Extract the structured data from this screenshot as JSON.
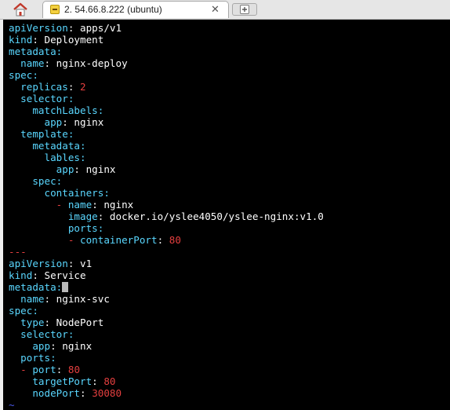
{
  "tabbar": {
    "home_icon": "home-icon",
    "tab_label": "2. 54.66.8.222 (ubuntu)",
    "tab_icon": "terminal-icon",
    "close_label": "✕",
    "new_tab_icon": "plus-icon"
  },
  "colors": {
    "key": "#5ad7ff",
    "special": "#e53f3f",
    "text": "#ffffff",
    "background": "#000000",
    "tilde": "#4a58e8"
  },
  "lines": [
    [
      {
        "t": "apiVersion",
        "c": "k"
      },
      {
        "t": ": apps/v1"
      }
    ],
    [
      {
        "t": "kind",
        "c": "k"
      },
      {
        "t": ": Deployment"
      }
    ],
    [
      {
        "t": "metadata:",
        "c": "k"
      }
    ],
    [
      {
        "t": "  "
      },
      {
        "t": "name",
        "c": "k"
      },
      {
        "t": ": nginx-deploy"
      }
    ],
    [
      {
        "t": "spec:",
        "c": "k"
      }
    ],
    [
      {
        "t": "  "
      },
      {
        "t": "replicas",
        "c": "k"
      },
      {
        "t": ": "
      },
      {
        "t": "2",
        "c": "s"
      }
    ],
    [
      {
        "t": "  "
      },
      {
        "t": "selector:",
        "c": "k"
      }
    ],
    [
      {
        "t": "    "
      },
      {
        "t": "matchLabels:",
        "c": "k"
      }
    ],
    [
      {
        "t": "      "
      },
      {
        "t": "app",
        "c": "k"
      },
      {
        "t": ": nginx"
      }
    ],
    [
      {
        "t": "  "
      },
      {
        "t": "template:",
        "c": "k"
      }
    ],
    [
      {
        "t": "    "
      },
      {
        "t": "metadata:",
        "c": "k"
      }
    ],
    [
      {
        "t": "      "
      },
      {
        "t": "lables:",
        "c": "k"
      }
    ],
    [
      {
        "t": "        "
      },
      {
        "t": "app",
        "c": "k"
      },
      {
        "t": ": nginx"
      }
    ],
    [
      {
        "t": "    "
      },
      {
        "t": "spec:",
        "c": "k"
      }
    ],
    [
      {
        "t": "      "
      },
      {
        "t": "containers:",
        "c": "k"
      }
    ],
    [
      {
        "t": "        "
      },
      {
        "t": "- ",
        "c": "s"
      },
      {
        "t": "name",
        "c": "k"
      },
      {
        "t": ": nginx"
      }
    ],
    [
      {
        "t": "          "
      },
      {
        "t": "image",
        "c": "k"
      },
      {
        "t": ": docker.io/yslee4050/yslee-nginx:v1.0"
      }
    ],
    [
      {
        "t": "          "
      },
      {
        "t": "ports:",
        "c": "k"
      }
    ],
    [
      {
        "t": "          "
      },
      {
        "t": "- ",
        "c": "s"
      },
      {
        "t": "containerPort",
        "c": "k"
      },
      {
        "t": ": "
      },
      {
        "t": "80",
        "c": "s"
      }
    ],
    [
      {
        "t": "---",
        "c": "s"
      }
    ],
    [
      {
        "t": "apiVersion",
        "c": "k"
      },
      {
        "t": ": v1"
      }
    ],
    [
      {
        "t": "kind",
        "c": "k"
      },
      {
        "t": ": Service"
      }
    ],
    [
      {
        "t": "metadata:",
        "c": "k"
      },
      {
        "t": "",
        "cursor": true
      }
    ],
    [
      {
        "t": "  "
      },
      {
        "t": "name",
        "c": "k"
      },
      {
        "t": ": nginx-svc"
      }
    ],
    [
      {
        "t": "spec:",
        "c": "k"
      }
    ],
    [
      {
        "t": "  "
      },
      {
        "t": "type",
        "c": "k"
      },
      {
        "t": ": NodePort"
      }
    ],
    [
      {
        "t": "  "
      },
      {
        "t": "selector:",
        "c": "k"
      }
    ],
    [
      {
        "t": "    "
      },
      {
        "t": "app",
        "c": "k"
      },
      {
        "t": ": nginx"
      }
    ],
    [
      {
        "t": "  "
      },
      {
        "t": "ports:",
        "c": "k"
      }
    ],
    [
      {
        "t": "  "
      },
      {
        "t": "- ",
        "c": "s"
      },
      {
        "t": "port",
        "c": "k"
      },
      {
        "t": ": "
      },
      {
        "t": "80",
        "c": "s"
      }
    ],
    [
      {
        "t": "    "
      },
      {
        "t": "targetPort",
        "c": "k"
      },
      {
        "t": ": "
      },
      {
        "t": "80",
        "c": "s"
      }
    ],
    [
      {
        "t": "    "
      },
      {
        "t": "nodePort",
        "c": "k"
      },
      {
        "t": ": "
      },
      {
        "t": "30080",
        "c": "s"
      }
    ],
    [
      {
        "t": "~",
        "c": "tilde"
      }
    ]
  ]
}
